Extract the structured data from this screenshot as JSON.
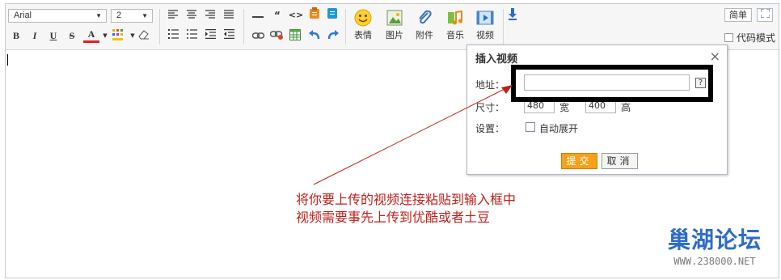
{
  "toolbar": {
    "font_select": "Arial",
    "size_select": "2",
    "bold": "B",
    "italic": "I",
    "underline": "U",
    "strike": "S",
    "font_color": "A",
    "quote": "“",
    "code": "<>",
    "big_buttons": [
      {
        "icon": "smiley-icon",
        "label": "表情"
      },
      {
        "icon": "image-icon",
        "label": "图片"
      },
      {
        "icon": "paperclip-icon",
        "label": "附件"
      },
      {
        "icon": "music-icon",
        "label": "音乐"
      },
      {
        "icon": "video-icon",
        "label": "视频"
      }
    ],
    "simple_button": "简单",
    "code_mode_label": "代码模式"
  },
  "dialog": {
    "title": "插入视频",
    "close": "×",
    "url_label": "地址：",
    "url_value": "",
    "help": "?",
    "size_label": "尺寸：",
    "width_value": "480",
    "width_label": "宽",
    "height_value": "400",
    "height_label": "高",
    "settings_label": "设置：",
    "autoplay_label": "自动展开",
    "submit": "提交",
    "cancel": "取消"
  },
  "annotation": {
    "line1": "将你要上传的视频连接粘贴到输入框中",
    "line2": "视频需要事先上传到优酷或者土豆"
  },
  "watermark": {
    "logo": "巢湖论坛",
    "url": "WWW.238000.NET"
  },
  "colors": {
    "annotation": "#c0201c",
    "arrow": "#c0201c",
    "submit_bg": "#f6a11a",
    "watermark_blue": "#2d6cc7"
  }
}
